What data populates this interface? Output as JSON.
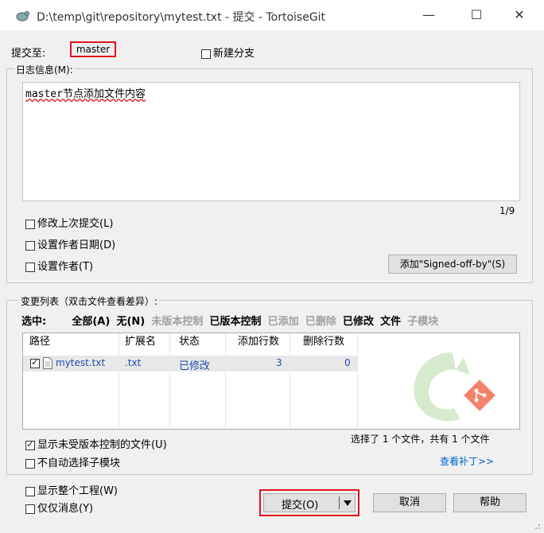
{
  "window": {
    "title": "D:\\temp\\git\\repository\\mytest.txt - 提交 - TortoiseGit",
    "minimize": "—",
    "maximize": "☐",
    "close": "✕"
  },
  "commit_to": {
    "label": "提交至:",
    "branch": "master",
    "new_branch_label": "新建分支"
  },
  "log": {
    "label": "日志信息(M):",
    "message": "master节点添加文件内容",
    "counter": "1/9"
  },
  "options": {
    "amend": "修改上次提交(L)",
    "set_date": "设置作者日期(D)",
    "set_author": "设置作者(T)",
    "signoff_button": "添加\"Signed-off-by\"(S)"
  },
  "changes": {
    "label": "变更列表（双击文件查看差异）:",
    "select_label": "选中:",
    "filters": [
      {
        "text": "全部(A)",
        "style": "bold"
      },
      {
        "text": "无(N)",
        "style": "bold"
      },
      {
        "text": "未版本控制",
        "style": "gray"
      },
      {
        "text": "已版本控制",
        "style": "bold"
      },
      {
        "text": "已添加",
        "style": "gray"
      },
      {
        "text": "已删除",
        "style": "gray"
      },
      {
        "text": "已修改",
        "style": "bold"
      },
      {
        "text": "文件",
        "style": "bold"
      },
      {
        "text": "子模块",
        "style": "gray"
      }
    ],
    "columns": [
      "路径",
      "扩展名",
      "状态",
      "添加行数",
      "删除行数"
    ],
    "rows": [
      {
        "path": "mytest.txt",
        "ext": ".txt",
        "status": "已修改",
        "added": "3",
        "deleted": "0",
        "checked": true
      }
    ],
    "show_unversioned": "显示未受版本控制的文件(U)",
    "no_auto_submodule": "不自动选择子模块",
    "summary": "选择了 1 个文件，共有 1 个文件",
    "view_patch": "查看补丁>>"
  },
  "bottom": {
    "show_project": "显示整个工程(W)",
    "message_only": "仅仅消息(Y)",
    "commit_button": "提交(O)",
    "cancel_button": "取消",
    "help_button": "帮助"
  },
  "colors": {
    "highlight_red": "#e1141b",
    "link_blue": "#0066cc",
    "status_blue": "#1e4fb0"
  }
}
